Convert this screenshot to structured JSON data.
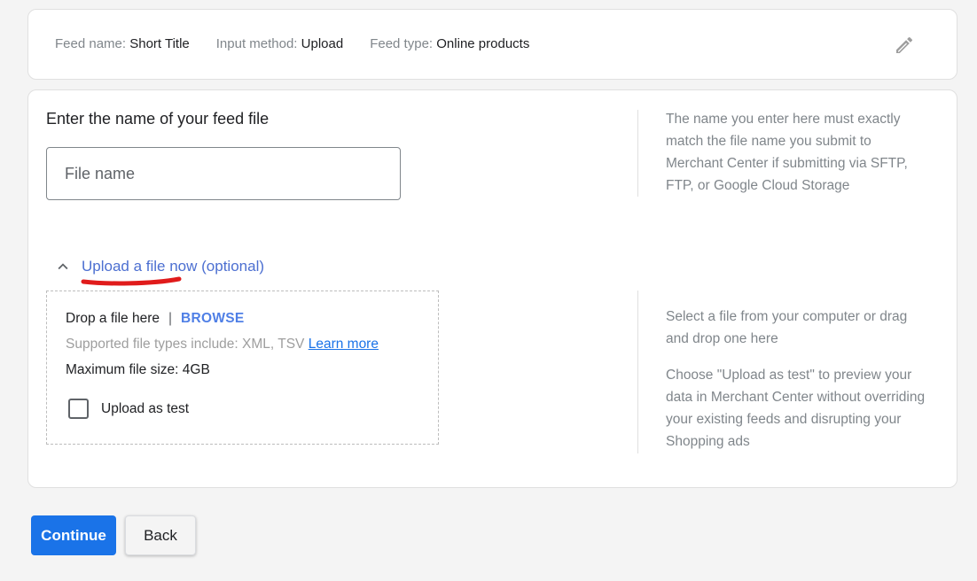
{
  "summary": {
    "feed_name_label": "Feed name:",
    "feed_name_value": "Short Title",
    "input_method_label": "Input method:",
    "input_method_value": "Upload",
    "feed_type_label": "Feed type:",
    "feed_type_value": "Online products",
    "edit_icon": "pencil-icon"
  },
  "file_name_section": {
    "title": "Enter the name of your feed file",
    "input_value": "",
    "input_placeholder": "File name",
    "help_text": "The name you enter here must exactly match the file name you submit to Merchant Center if submitting via SFTP, FTP, or Google Cloud Storage"
  },
  "upload_section": {
    "toggle_label": "Upload a file now (optional)",
    "toggle_icon": "chevron-up-icon",
    "expanded": true,
    "drop_text": "Drop a file here",
    "separator": "|",
    "browse_label": "BROWSE",
    "supported_types_text": "Supported file types include: XML, TSV",
    "learn_more_label": "Learn more",
    "max_size_text": "Maximum file size: 4GB",
    "upload_as_test_label": "Upload as test",
    "upload_as_test_checked": false,
    "help_text_1": "Select a file from your computer or drag and drop one here",
    "help_text_2": "Choose \"Upload as test\" to preview your data in Merchant Center without overriding your existing feeds and disrupting your Shopping ads"
  },
  "annotation": {
    "red_underline_color": "#e01b1b"
  },
  "footer": {
    "continue_label": "Continue",
    "back_label": "Back"
  },
  "colors": {
    "primary": "#1a73e8",
    "link": "#4c6fd1",
    "background": "#f4f4f4"
  }
}
